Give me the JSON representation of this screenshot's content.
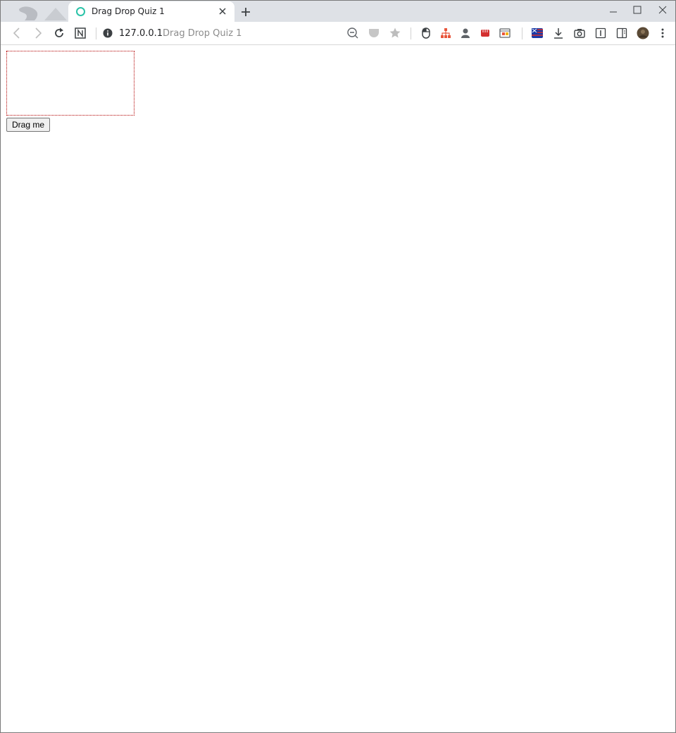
{
  "tab": {
    "title": "Drag Drop Quiz 1"
  },
  "address_bar": {
    "host": "127.0.0.1",
    "title": "Drag Drop Quiz 1"
  },
  "page": {
    "drag_button_label": "Drag me"
  },
  "colors": {
    "favicon_ring": "#2bc3a8",
    "dropzone_border": "#b30000",
    "tabstrip_bg": "#dee1e6"
  }
}
